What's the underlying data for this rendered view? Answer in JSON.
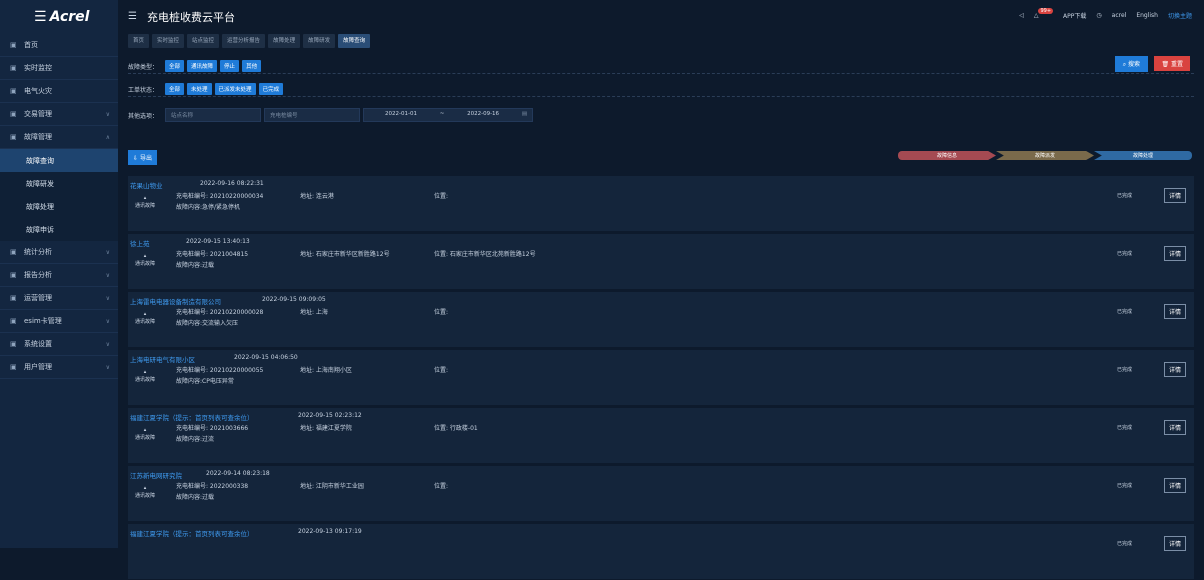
{
  "logo": "Acrel",
  "app_title": "充电桩收费云平台",
  "topbar": {
    "app_download": "APP下载",
    "user": "acrel",
    "english": "English",
    "switch_theme": "切换主题",
    "badge": "99+"
  },
  "sidebar": [
    {
      "label": "首页",
      "icon": "home-icon"
    },
    {
      "label": "实时监控",
      "icon": "monitor-icon"
    },
    {
      "label": "电气火灾",
      "icon": "fire-icon"
    },
    {
      "label": "交易管理",
      "icon": "trade-icon",
      "chevron": true
    },
    {
      "label": "故障管理",
      "icon": "fault-icon",
      "chevron": true,
      "expanded": true
    }
  ],
  "sidebar_sub": [
    {
      "label": "故障查询",
      "active": true
    },
    {
      "label": "故障研发"
    },
    {
      "label": "故障处理"
    },
    {
      "label": "故障申诉"
    }
  ],
  "sidebar_rest": [
    {
      "label": "统计分析",
      "icon": "chart-icon"
    },
    {
      "label": "报告分析",
      "icon": "report-icon"
    },
    {
      "label": "运营管理",
      "icon": "ops-icon"
    },
    {
      "label": "esim卡管理",
      "icon": "sim-icon"
    },
    {
      "label": "系统设置",
      "icon": "settings-icon"
    },
    {
      "label": "用户管理",
      "icon": "user-icon"
    }
  ],
  "tabs": [
    "首页",
    "实时监控",
    "站点监控",
    "运营分析报告",
    "故障处理",
    "故障研发",
    "故障查询"
  ],
  "filters": {
    "fault_type_label": "故障类型：",
    "fault_types": [
      "全部",
      "通讯故障",
      "停止",
      "其他"
    ],
    "order_status_label": "工单状态：",
    "order_statuses": [
      "全部",
      "未处理",
      "已派发未处理",
      "已完成"
    ],
    "other_label": "其他选项：",
    "station_placeholder": "站点名称",
    "pile_placeholder": "充电桩编号",
    "date_start": "2022-01-01",
    "date_sep": "~",
    "date_end": "2022-09-16"
  },
  "buttons": {
    "search": "搜索",
    "reset": "重置",
    "export": "导出"
  },
  "progress": [
    "故障信息",
    "故障派发",
    "故障处理"
  ],
  "cards": [
    {
      "name": "花果山物业",
      "time": "2022-09-16 08:22:31",
      "type": "通讯故障",
      "pile": "充电桩编号: 20210220000034",
      "address": "地址: 连云港",
      "location": "位置:",
      "content": "故障内容:急停/紧急停机",
      "status": "已完成",
      "detail": "详情"
    },
    {
      "name": "徐上苑",
      "time": "2022-09-15 13:40:13",
      "type": "通讯故障",
      "pile": "充电桩编号: 2021004815",
      "address": "地址: 石家庄市新华区新胜路12号",
      "location": "位置: 石家庄市新华区北苑新胜路12号",
      "content": "故障内容:过载",
      "status": "已完成",
      "detail": "详情"
    },
    {
      "name": "上海雷电电器设备制造有限公司",
      "time": "2022-09-15 09:09:05",
      "type": "通讯故障",
      "pile": "充电桩编号: 20210220000028",
      "address": "地址: 上海",
      "location": "位置:",
      "content": "故障内容:交流输入欠压",
      "status": "已完成",
      "detail": "详情"
    },
    {
      "name": "上海电研电气有限小区",
      "time": "2022-09-15 04:06:50",
      "type": "通讯故障",
      "pile": "充电桩编号: 20210220000055",
      "address": "地址: 上海南翔小区",
      "location": "位置:",
      "content": "故障内容:CP电压异常",
      "status": "已完成",
      "detail": "详情"
    },
    {
      "name": "福建江夏学院（提示：首页列表可查余位）",
      "time": "2022-09-15 02:23:12",
      "type": "通讯故障",
      "pile": "充电桩编号: 2021003666",
      "address": "地址: 福建江夏学院",
      "location": "位置: 行政楼-01",
      "content": "故障内容:过流",
      "status": "已完成",
      "detail": "详情"
    },
    {
      "name": "江苏新电网研究院",
      "time": "2022-09-14 08:23:18",
      "type": "通讯故障",
      "pile": "充电桩编号: 2022000338",
      "address": "地址: 江阴市新华工业园",
      "location": "位置:",
      "content": "故障内容:过载",
      "status": "已完成",
      "detail": "详情"
    },
    {
      "name": "福建江夏学院（提示：首页列表可查余位）",
      "time": "2022-09-13 09:17:19",
      "type": "",
      "pile": "",
      "address": "",
      "location": "",
      "content": "",
      "status": "已完成",
      "detail": "详情"
    }
  ]
}
